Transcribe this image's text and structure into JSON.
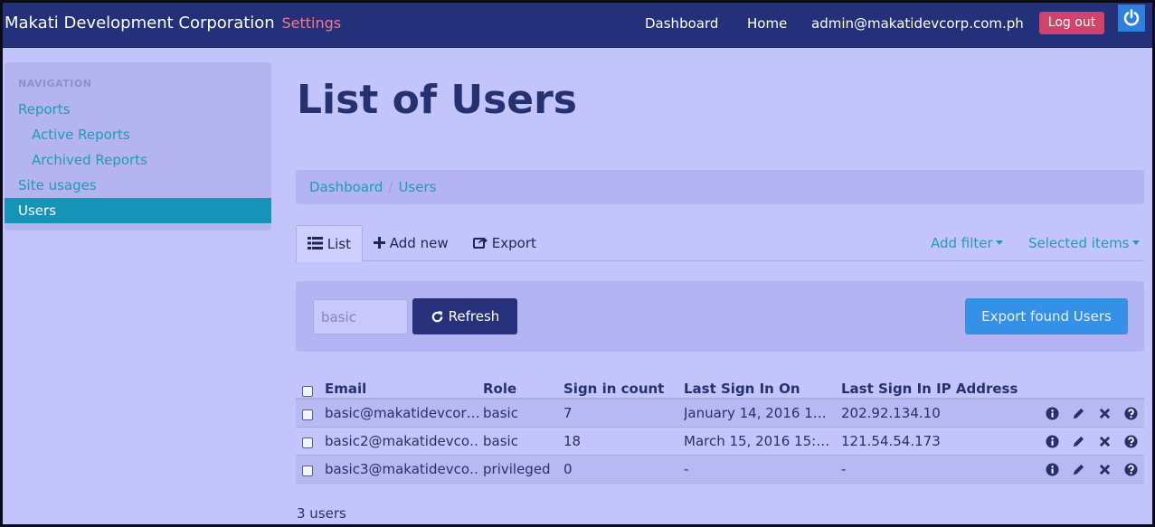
{
  "navbar": {
    "brand": "Makati Development Corporation",
    "brand_section": "Settings",
    "links": [
      "Dashboard",
      "Home",
      "admin@makatidevcorp.com.ph"
    ],
    "logout_label": "Log out"
  },
  "sidebar": {
    "header": "NAVIGATION",
    "items": [
      {
        "label": "Reports"
      },
      {
        "label": "Active Reports"
      },
      {
        "label": "Archived Reports"
      },
      {
        "label": "Site usages"
      },
      {
        "label": "Users"
      }
    ]
  },
  "page": {
    "title": "List of Users",
    "breadcrumb": [
      "Dashboard",
      "Users"
    ],
    "tabs": {
      "list": "List",
      "add_new": "Add new",
      "export": "Export",
      "add_filter": "Add filter",
      "selected_items": "Selected items"
    },
    "filter": {
      "value": "basic",
      "refresh_label": "Refresh",
      "export_label": "Export found Users"
    },
    "table": {
      "headers": [
        "Email",
        "Role",
        "Sign in count",
        "Last Sign In On",
        "Last Sign In IP Address"
      ],
      "rows": [
        {
          "email": "basic@makatidevcor…",
          "role": "basic",
          "sign_in_count": "7",
          "last_sign_in_on": "January 14, 2016 1…",
          "ip": "202.92.134.10"
        },
        {
          "email": "basic2@makatidevco…",
          "role": "basic",
          "sign_in_count": "18",
          "last_sign_in_on": "March 15, 2016 15:…",
          "ip": "121.54.54.173"
        },
        {
          "email": "basic3@makatidevco…",
          "role": "privileged",
          "sign_in_count": "0",
          "last_sign_in_on": "-",
          "ip": "-"
        }
      ]
    },
    "count_text": "3 users"
  },
  "colors": {
    "navbar": "#25307a",
    "background": "#c4c4fc",
    "link": "#1f9bb7",
    "logout": "#d0436a",
    "primary_button": "#27307a",
    "export_button": "#3590e8"
  }
}
